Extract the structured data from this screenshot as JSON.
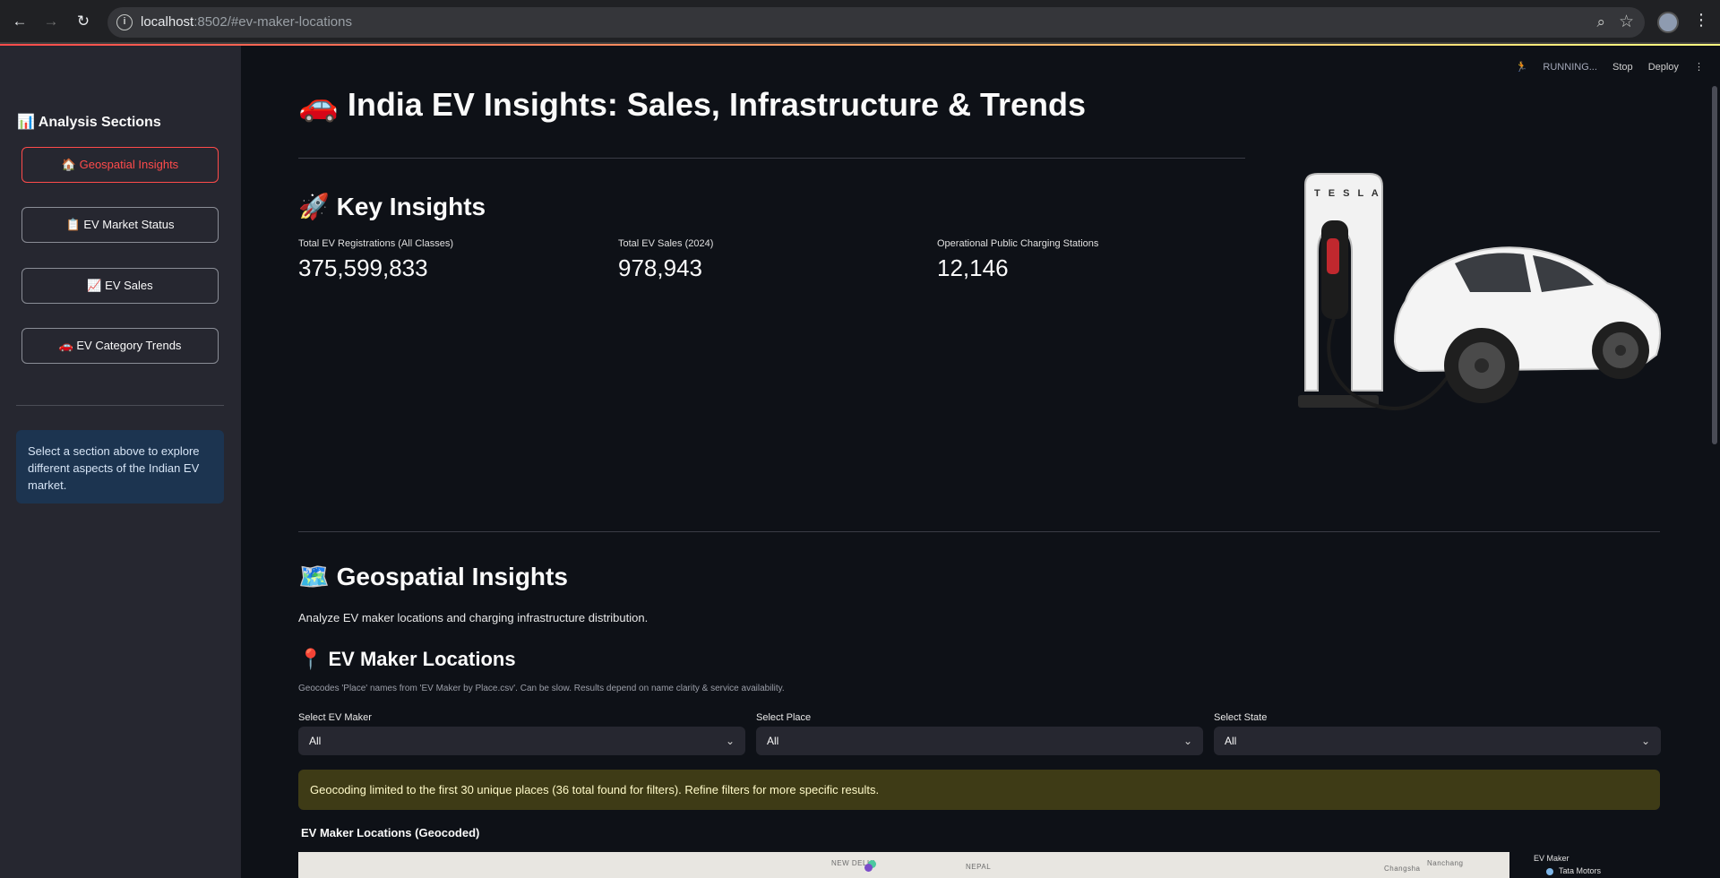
{
  "browser": {
    "url_host": "localhost",
    "url_rest": ":8502/#ev-maker-locations",
    "back_icon": "←",
    "forward_icon": "→",
    "reload_icon": "↻",
    "menu_icon": "⋮"
  },
  "sidebar": {
    "title": "📊 Analysis Sections",
    "items": [
      {
        "label": "🏠 Geospatial Insights",
        "active": true
      },
      {
        "label": "📋 EV Market Status"
      },
      {
        "label": "📈 EV Sales"
      },
      {
        "label": "🚗 EV Category Trends"
      }
    ],
    "info": "Select a section above to explore different aspects of the Indian EV market."
  },
  "topbar": {
    "status": "RUNNING...",
    "stop": "Stop",
    "deploy": "Deploy",
    "menu": "⋮"
  },
  "page": {
    "title": "🚗 India EV Insights: Sales, Infrastructure & Trends",
    "key_insights_heading": "🚀 Key Insights",
    "metrics": [
      {
        "label": "Total EV Registrations (All Classes)",
        "value": "375,599,833"
      },
      {
        "label": "Total EV Sales (2024)",
        "value": "978,943"
      },
      {
        "label": "Operational Public Charging Stations",
        "value": "12,146"
      }
    ],
    "geo_heading": "🗺️ Geospatial Insights",
    "geo_desc": "Analyze EV maker locations and charging infrastructure distribution.",
    "maker_heading": "📍 EV Maker Locations",
    "caption": "Geocodes 'Place' names from 'EV Maker by Place.csv'. Can be slow. Results depend on name clarity & service availability.",
    "filters": [
      {
        "label": "Select EV Maker",
        "value": "All"
      },
      {
        "label": "Select Place",
        "value": "All"
      },
      {
        "label": "Select State",
        "value": "All"
      }
    ],
    "warning": "Geocoding limited to the first 30 unique places (36 total found for filters). Refine filters for more specific results.",
    "map_title": "EV Maker Locations (Geocoded)",
    "map_labels": [
      "NEW DELHI",
      "NEPAL",
      "Nanchang",
      "Changsha"
    ],
    "legend_title": "EV Maker",
    "legend_items": [
      "Tata Motors"
    ]
  },
  "colors": {
    "accent": "#ff4b4b",
    "background": "#0e1117",
    "sidebar": "#262730"
  }
}
